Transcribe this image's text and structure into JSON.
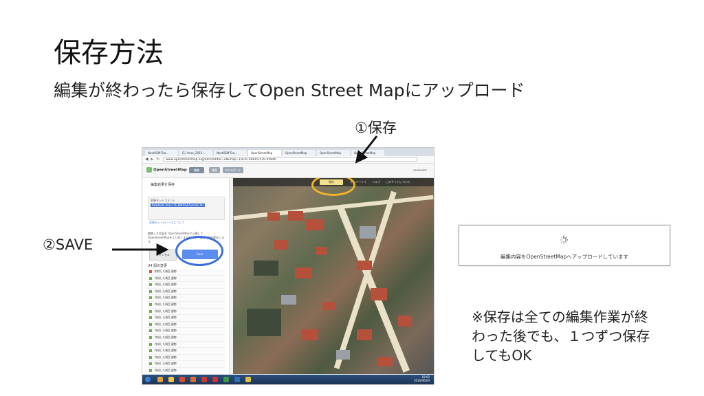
{
  "slide": {
    "title": "保存方法",
    "subtitle": "編集が終わったら保存してOpen Street Mapにアップロード",
    "callout_save": "①保存",
    "callout_upload": "②SAVE",
    "note": "※保存は全ての編集作業が終わった後でも、１つずつ保存してもOK"
  },
  "screenshot": {
    "tabs": [
      "NextOSM-Tea...",
      "[1] #osc_2015...",
      "NextOSM-Tea...",
      "OpenStreetMap",
      "OpenStreetMap",
      "OpenStreetMap",
      "OpenStreetMap"
    ],
    "url": "www.openstreetmap.org/edit?editor=id&map=19/35.49815/139.45840",
    "logo": "OpenStreetMap",
    "toolbar_buttons": [
      "編集",
      "履歴",
      "エクスポート"
    ],
    "sidebar_title": "編集結果を保存",
    "changeset_label": "変更セットコメント",
    "changeset_text": "Roadside Area (TE BRIDGE/Sonde) for",
    "check_label": "変更セットのソースについて",
    "info_text": "編集した内容を OpenStreetMapで公開して、OpenStreetMapをより良くするために、編集内容を保存します。",
    "cancel_label": "キャンセル",
    "save_label": "Save",
    "changes_header": "34 個の変更",
    "changes": [
      {
        "label": "削除した項目 建物",
        "type": "del"
      },
      {
        "label": "作成した項目 建物",
        "type": "add"
      },
      {
        "label": "作成した項目 建物",
        "type": "add"
      },
      {
        "label": "作成した項目 建物",
        "type": "add"
      },
      {
        "label": "作成した項目 建物",
        "type": "add"
      },
      {
        "label": "作成した項目 建物",
        "type": "add"
      },
      {
        "label": "作成した項目 建物",
        "type": "add"
      },
      {
        "label": "作成した項目 建物",
        "type": "add"
      },
      {
        "label": "作成した項目 建物",
        "type": "add"
      },
      {
        "label": "作成した項目 建物",
        "type": "add"
      },
      {
        "label": "作成した項目 建物",
        "type": "add"
      },
      {
        "label": "作成した項目 建物",
        "type": "add"
      },
      {
        "label": "作成した項目 建物",
        "type": "add"
      },
      {
        "label": "作成した項目 建物",
        "type": "add"
      },
      {
        "label": "作成した項目 建物",
        "type": "add"
      },
      {
        "label": "作成した項目 建物",
        "type": "add"
      },
      {
        "label": "作成した項目 建物",
        "type": "add"
      }
    ],
    "map_toolbar": [
      "オーバーレイ",
      "ヘルプ",
      "このサイトについて"
    ],
    "map_save_label": "保存",
    "user_label": "username",
    "clock_time": "19:02",
    "clock_date": "2016/06/04"
  },
  "upload_dialog": {
    "message": "編集内容をOpenStreetMapへアップロードしています"
  }
}
